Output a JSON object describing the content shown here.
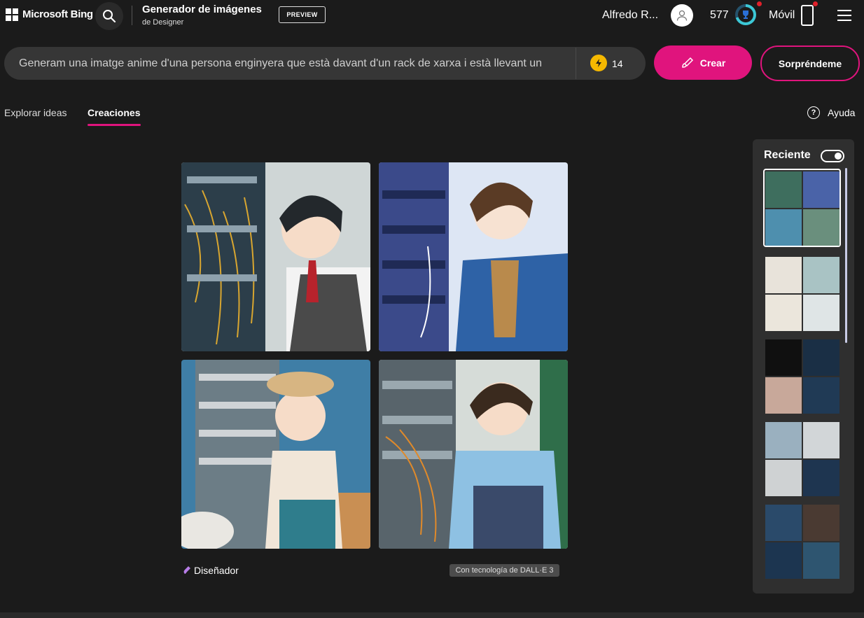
{
  "header": {
    "brand": "Microsoft Bing",
    "app_title": "Generador de imágenes",
    "app_subtitle": "de Designer",
    "preview_badge": "PREVIEW",
    "user_name": "Alfredo R...",
    "points": "577",
    "mobile_label": "Móvil"
  },
  "prompt": {
    "text": "Generam una imatge anime d'una persona enginyera que està davant d'un rack de xarxa i està llevant un",
    "boosts": "14",
    "create_label": "Crear",
    "surprise_label": "Sorpréndeme"
  },
  "tabs": {
    "explore": "Explorar ideas",
    "creations": "Creaciones",
    "help": "Ayuda"
  },
  "gallery": {
    "designer_label": "Diseñador",
    "dalle_label": "Con tecnología de DALL·E 3"
  },
  "sidebar": {
    "title": "Reciente"
  },
  "colors": {
    "accent": "#e0147d",
    "background": "#1b1b1b",
    "panel": "#2f2f2f",
    "input": "#363636"
  }
}
